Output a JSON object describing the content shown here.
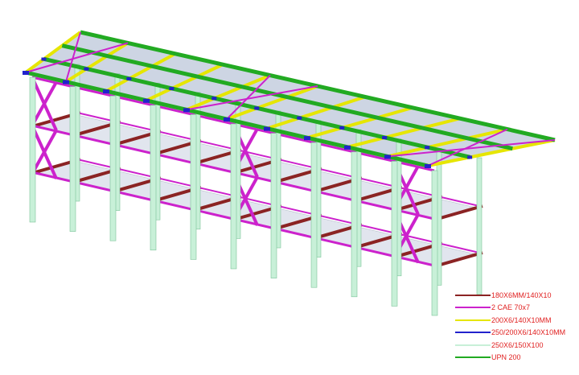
{
  "legend": [
    {
      "label": "180X6MM/140X10",
      "color": "#8b2323",
      "text_color": "#e02020"
    },
    {
      "label": "2 CAE 70x7",
      "color": "#cc22cc",
      "text_color": "#e02020"
    },
    {
      "label": "200X6/140X10MM",
      "color": "#e6e600",
      "text_color": "#e02020"
    },
    {
      "label": "250/200X6/140X10MM",
      "color": "#2222cc",
      "text_color": "#e02020"
    },
    {
      "label": "250X6/150X100",
      "color": "#c8f0d8",
      "text_color": "#e02020"
    },
    {
      "label": "UPN 200",
      "color": "#22aa22",
      "text_color": "#e02020"
    }
  ],
  "colors": {
    "column": "#c8f0d8",
    "column_edge": "#7cc49a",
    "beam_longitudinal": "#cc22cc",
    "beam_transverse": "#8b2323",
    "brace": "#cc22cc",
    "roof_purlin": "#22aa22",
    "roof_joist": "#e6e600",
    "roof_connector": "#2222cc",
    "deck": "#c8d0e0"
  }
}
